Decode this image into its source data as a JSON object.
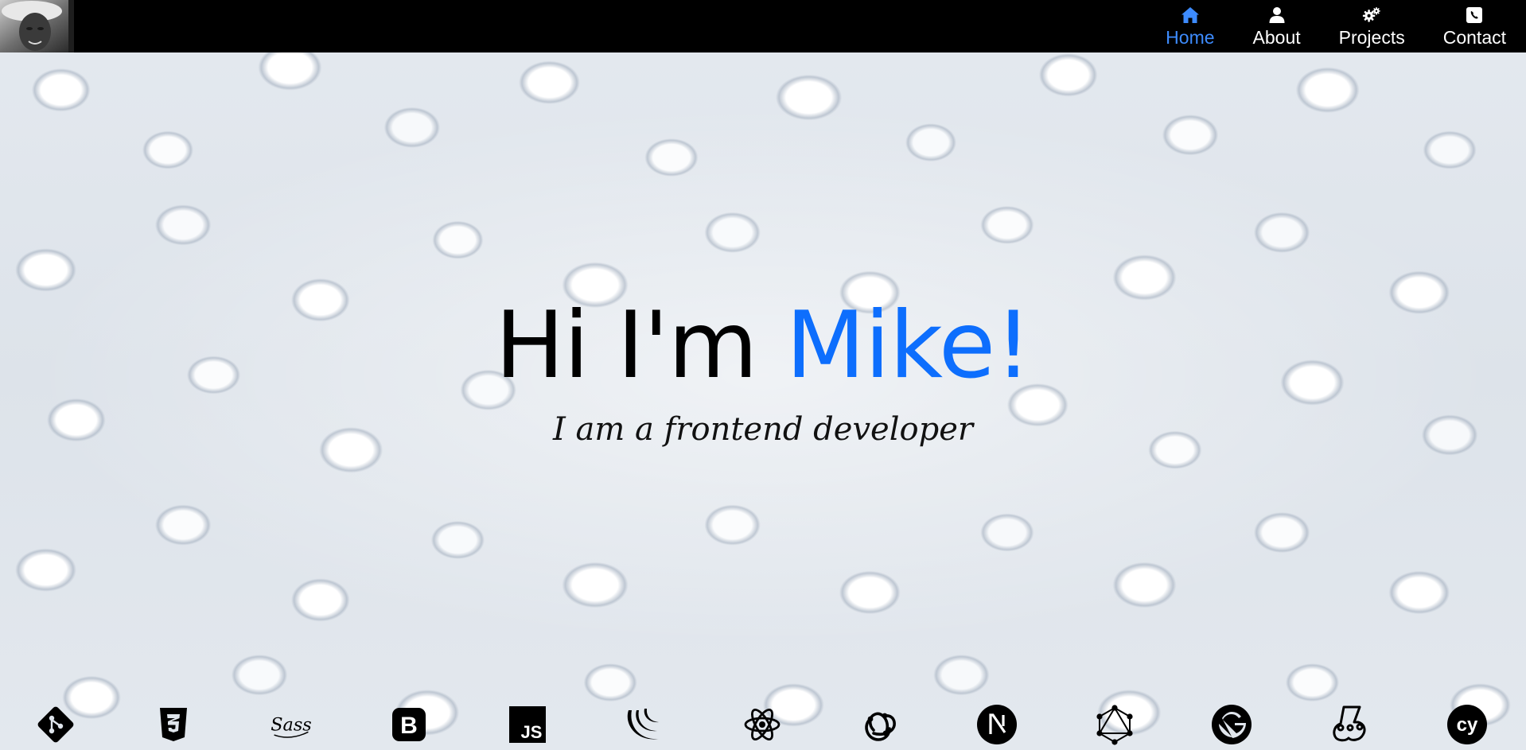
{
  "navbar": {
    "avatar_icon": "profile-photo",
    "items": [
      {
        "label": "Home",
        "icon": "home-icon",
        "active": true
      },
      {
        "label": "About",
        "icon": "user-icon",
        "active": false
      },
      {
        "label": "Projects",
        "icon": "gears-icon",
        "active": false
      },
      {
        "label": "Contact",
        "icon": "contact-card-icon",
        "active": false
      }
    ]
  },
  "hero": {
    "greeting": "Hi I'm",
    "name": "Mike!",
    "tagline": "I am a frontend developer"
  },
  "tech_stack": [
    {
      "name": "git-icon"
    },
    {
      "name": "css3-icon"
    },
    {
      "name": "sass-icon",
      "text": "Sass"
    },
    {
      "name": "bootstrap-icon",
      "text": "B"
    },
    {
      "name": "javascript-icon",
      "text": "JS"
    },
    {
      "name": "jquery-icon"
    },
    {
      "name": "react-icon"
    },
    {
      "name": "redux-icon"
    },
    {
      "name": "nextjs-icon",
      "text": "N"
    },
    {
      "name": "graphql-icon"
    },
    {
      "name": "gatsby-icon"
    },
    {
      "name": "jest-icon"
    },
    {
      "name": "cypress-icon",
      "text": "cy"
    }
  ],
  "colors": {
    "navbar_bg": "#000000",
    "nav_text": "#ffffff",
    "nav_active": "#3d8bfd",
    "headline_text": "#000000",
    "accent": "#0d6efd",
    "icon_color": "#000000"
  }
}
